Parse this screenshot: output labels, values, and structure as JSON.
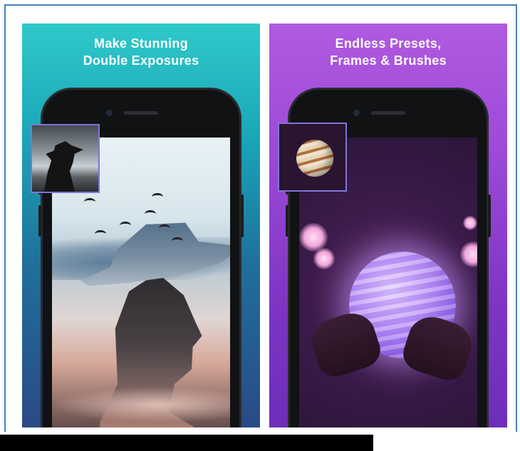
{
  "cards": [
    {
      "headline_line1": "Make Stunning",
      "headline_line2": "Double Exposures"
    },
    {
      "headline_line1": "Endless Presets,",
      "headline_line2": "Frames & Brushes"
    }
  ],
  "colors": {
    "frame_border": "#4a7fc1",
    "left_card_top": "#2fc9c9",
    "left_card_bottom": "#2b4a85",
    "right_card_top": "#b05ae0",
    "right_card_bottom": "#6e2eb8",
    "thumbnail_border": "#7f74d8",
    "headline_text": "#ffffff"
  },
  "icons": {
    "left_thumbnail": "silhouette-with-hat-image",
    "right_thumbnail": "jupiter-planet-image"
  }
}
